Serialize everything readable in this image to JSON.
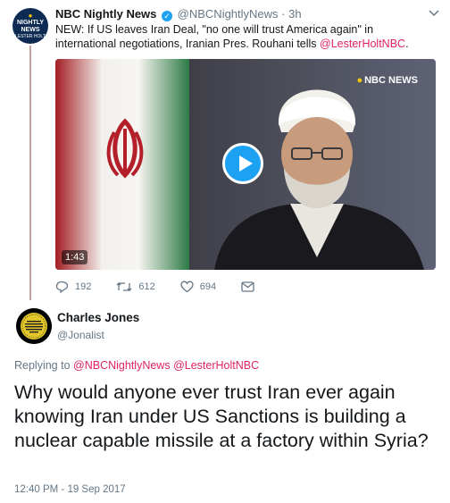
{
  "tweet1": {
    "avatar": {
      "brand": "NBC",
      "line1": "NIGHTLY",
      "line2": "NEWS",
      "line3": "LESTER HOLT"
    },
    "name": "NBC Nightly News",
    "handle": "@NBCNightlyNews",
    "separator": "·",
    "age": "3h",
    "text_before": "NEW: If US leaves Iran Deal, \"no one will trust America again\" in international negotiations, Iranian Pres. Rouhani tells ",
    "mention": "@LesterHoltNBC",
    "text_after": ".",
    "video": {
      "network_badge": "NBC NEWS",
      "duration": "1:43"
    },
    "actions": {
      "replies": "192",
      "retweets": "612",
      "likes": "694"
    }
  },
  "reply": {
    "name": "Charles Jones",
    "handle": "@Jonalist",
    "replying_prefix": "Replying to",
    "replying_to": [
      "@NBCNightlyNews",
      "@LesterHoltNBC"
    ],
    "text": "Why would anyone ever trust Iran ever again knowing Iran under US Sanctions is building a nuclear capable missile at a factory within Syria?",
    "timestamp": "12:40 PM - 19 Sep 2017"
  },
  "colors": {
    "accent": "#1da1f2",
    "mention": "#e0245e",
    "muted": "#657786",
    "thread_line": "#c7a3a8"
  },
  "icons": [
    "verified-icon",
    "chevron-down-icon",
    "play-icon",
    "reply-icon",
    "retweet-icon",
    "like-icon",
    "dm-icon"
  ]
}
